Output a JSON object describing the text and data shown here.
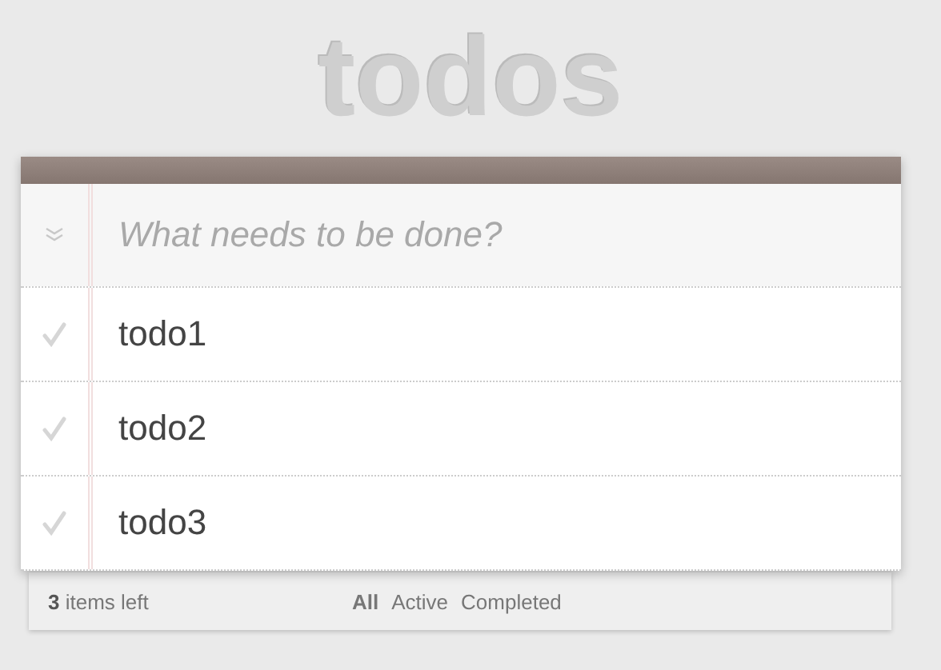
{
  "title": "todos",
  "new_todo": {
    "placeholder": "What needs to be done?"
  },
  "todos": [
    {
      "label": "todo1",
      "completed": false
    },
    {
      "label": "todo2",
      "completed": false
    },
    {
      "label": "todo3",
      "completed": false
    }
  ],
  "footer": {
    "count": "**3** items left",
    "filters": [
      {
        "label": "All",
        "selected": true
      },
      {
        "label": "Active",
        "selected": false
      },
      {
        "label": "Completed",
        "selected": false
      }
    ]
  }
}
